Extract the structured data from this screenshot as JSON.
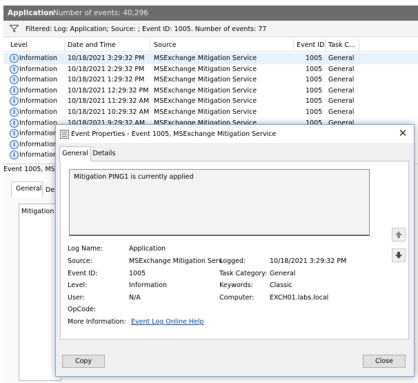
{
  "header": {
    "app": "Application",
    "count": "Number of events: 40,296"
  },
  "filter": {
    "text": "Filtered: Log: Application; Source: ; Event ID: 1005. Number of events: 77"
  },
  "columns": {
    "level": "Level",
    "date": "Date and Time",
    "source": "Source",
    "event_id": "Event ID",
    "task": "Task C..."
  },
  "rows": [
    {
      "level": "Information",
      "date": "10/18/2021 3:29:32 PM",
      "source": "MSExchange Mitigation Service",
      "id": "1005",
      "task": "General"
    },
    {
      "level": "Information",
      "date": "10/18/2021 2:29:32 PM",
      "source": "MSExchange Mitigation Service",
      "id": "1005",
      "task": "General"
    },
    {
      "level": "Information",
      "date": "10/18/2021 1:29:32 PM",
      "source": "MSExchange Mitigation Service",
      "id": "1005",
      "task": "General"
    },
    {
      "level": "Information",
      "date": "10/18/2021 12:29:32 PM",
      "source": "MSExchange Mitigation Service",
      "id": "1005",
      "task": "General"
    },
    {
      "level": "Information",
      "date": "10/18/2021 11:29:32 AM",
      "source": "MSExchange Mitigation Service",
      "id": "1005",
      "task": "General"
    },
    {
      "level": "Information",
      "date": "10/18/2021 10:29:32 AM",
      "source": "MSExchange Mitigation Service",
      "id": "1005",
      "task": "General"
    },
    {
      "level": "Information",
      "date": "10/18/2021 9:29:32 AM",
      "source": "MSExchange Mitigation Service",
      "id": "1005",
      "task": "General"
    },
    {
      "level": "Information",
      "date": "",
      "source": "",
      "id": "",
      "task": ""
    },
    {
      "level": "Information",
      "date": "",
      "source": "",
      "id": "",
      "task": ""
    },
    {
      "level": "Information",
      "date": "",
      "source": "",
      "id": "",
      "task": ""
    }
  ],
  "lower": {
    "header": "Event 1005, MS",
    "tab_general": "General",
    "tab_details": "De",
    "box_text": "Mitigation"
  },
  "dialog": {
    "title": "Event Properties - Event 1005, MSExchange Mitigation Service",
    "close": "✕",
    "tabs": {
      "general": "General",
      "details": "Details"
    },
    "message": "Mitigation PING1 is currently applied",
    "labels": {
      "log_name": "Log Name:",
      "source": "Source:",
      "event_id": "Event ID:",
      "level": "Level:",
      "user": "User:",
      "opcode": "OpCode:",
      "more_info": "More Information:",
      "logged": "Logged:",
      "task_category": "Task Category:",
      "keywords": "Keywords:",
      "computer": "Computer:"
    },
    "values": {
      "log_name": "Application",
      "source": "MSExchange Mitigation Serv",
      "event_id": "1005",
      "level": "Information",
      "user": "N/A",
      "opcode": "",
      "more_info_link": "Event Log Online Help",
      "logged": "10/18/2021 3:29:32 PM",
      "task_category": "General",
      "keywords": "Classic",
      "computer": "EXCH01.labs.local"
    },
    "buttons": {
      "copy": "Copy",
      "close": "Close"
    }
  },
  "icons": {
    "filter": "filter-icon",
    "info": "information-icon",
    "up": "arrow-up-icon",
    "down": "arrow-down-icon"
  }
}
